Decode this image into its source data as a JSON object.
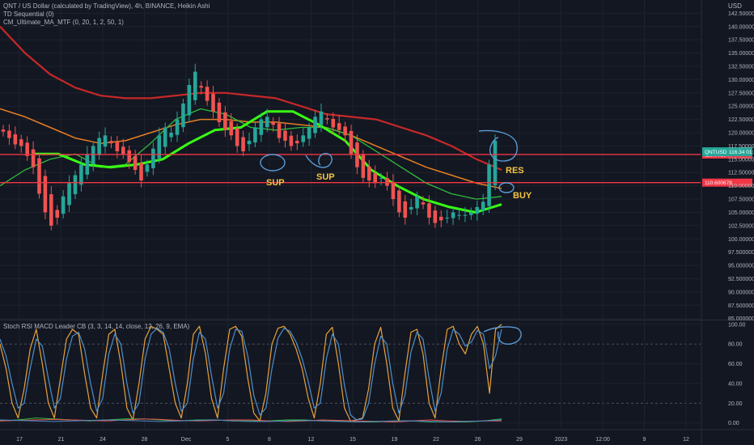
{
  "legend": {
    "title": "QNT / US Dollar (calculated by TradingView), 4h, BINANCE, Heikin Ashi",
    "ind1": "TD Sequential (0)",
    "ind2": "CM_Ultimate_MA_MTF (0, 20, 1, 2, 50, 1)",
    "osc": "Stoch RSI MACD Leader CB (3, 3, 14, 14, close, 12, 26, 9, EMA)"
  },
  "currency": "USD",
  "colors": {
    "background": "#131722",
    "up": "#26a69a",
    "down": "#ef5350",
    "grid": "#1e222d",
    "res_line": "#f23645",
    "annotation": "#f5c542",
    "drawing": "#5b9bd5",
    "ma_long": "#c62828",
    "ma_mid": "#e67e22",
    "ma_green": "#2ebd3c",
    "ma_bright": "#39ff14",
    "stoch_k": "#e8a23a",
    "stoch_d": "#4d8fcc"
  },
  "chart_data": [
    {
      "type": "candlestick",
      "x_ticks": [
        "17",
        "21",
        "24",
        "28",
        "Dec",
        "5",
        "8",
        "12",
        "15",
        "19",
        "22",
        "26",
        "29",
        "2023",
        "12:00",
        "9",
        "12"
      ],
      "y_ticks": [
        "142.500000",
        "140.000000",
        "137.500000",
        "135.000000",
        "132.500000",
        "130.000000",
        "127.500000",
        "125.000000",
        "122.500000",
        "120.000000",
        "117.500000",
        "115.000000",
        "112.500000",
        "110.000000",
        "107.500000",
        "105.000000",
        "102.500000",
        "100.000000",
        "97.500000",
        "95.000000",
        "92.500000",
        "90.000000",
        "87.500000",
        "85.000000"
      ],
      "ylim": [
        84.8,
        145.0
      ],
      "close": [
        120.2,
        119.0,
        117.8,
        117.5,
        115.6,
        113.5,
        108.5,
        105.0,
        102.5,
        104.0,
        108.0,
        110.5,
        112.0,
        114.0,
        116.0,
        117.5,
        119.0,
        119.5,
        118.0,
        116.5,
        116.0,
        114.5,
        113.0,
        111.0,
        114.0,
        117.0,
        119.5,
        121.0,
        120.0,
        122.5,
        125.5,
        129.0,
        131.5,
        128.5,
        126.0,
        124.0,
        122.0,
        120.5,
        119.5,
        117.5,
        116.5,
        118.5,
        121.0,
        122.5,
        123.0,
        121.5,
        119.0,
        118.5,
        117.5,
        118.0,
        119.5,
        121.0,
        123.0,
        124.0,
        122.5,
        121.0,
        120.5,
        119.5,
        116.0,
        113.5,
        111.5,
        111.0,
        110.5,
        111.5,
        110.0,
        107.5,
        105.0,
        104.0,
        106.0,
        108.0,
        106.5,
        104.0,
        103.0,
        103.5,
        104.0,
        105.0,
        104.5,
        104.5,
        105.0,
        106.0,
        107.0,
        114.0,
        118.5
      ],
      "resistance_lines": [
        {
          "value": 115.9,
          "label": "115.901944"
        },
        {
          "value": 110.6,
          "label": "110.600678"
        }
      ],
      "last_price": {
        "symbol": "QNTUSD",
        "value": "116.34",
        "sub": "01:34:54"
      },
      "moving_averages": [
        {
          "values": [
            140.0,
            135.0,
            131.0,
            128.5,
            127.0,
            126.5,
            126.5,
            127.0,
            127.5,
            127.5,
            127.0,
            126.5,
            125.0,
            123.5,
            123.0,
            122.5,
            121.0,
            119.5,
            117.5,
            115.0,
            113.0
          ]
        },
        {
          "values": [
            124.5,
            123.0,
            121.0,
            119.0,
            118.0,
            118.5,
            120.0,
            121.5,
            122.5,
            122.5,
            122.0,
            122.0,
            121.5,
            121.0,
            119.5,
            117.5,
            115.5,
            113.5,
            112.0,
            110.5,
            109.5
          ]
        },
        {
          "values": [
            110.0,
            113.0,
            115.0,
            116.0,
            113.5,
            114.0,
            118.0,
            122.5,
            124.5,
            123.5,
            121.0,
            120.5,
            121.0,
            121.0,
            119.5,
            116.5,
            113.5,
            110.5,
            108.5,
            107.5,
            108.0
          ]
        },
        {
          "values": [
            116.0,
            116.0,
            114.0,
            113.5,
            114.0,
            115.0,
            118.0,
            120.5,
            121.0,
            124.0,
            124.0,
            121.5,
            118.5,
            113.0,
            110.0,
            107.5,
            106.0,
            105.0,
            106.5
          ]
        }
      ],
      "annotations": [
        "SUP",
        "SUP",
        "RES",
        "BUY"
      ]
    },
    {
      "type": "line",
      "y_ticks": [
        "100.00",
        "80.00",
        "60.00",
        "40.00",
        "20.00",
        "0.00"
      ],
      "ylim": [
        -6,
        104
      ],
      "series": [
        {
          "values": [
            80,
            55,
            20,
            5,
            35,
            75,
            95,
            60,
            20,
            5,
            45,
            85,
            95,
            90,
            50,
            15,
            5,
            50,
            90,
            95,
            60,
            15,
            3,
            40,
            85,
            98,
            95,
            90,
            55,
            20,
            5,
            40,
            90,
            98,
            70,
            25,
            5,
            55,
            95,
            98,
            88,
            45,
            10,
            2,
            30,
            80,
            96,
            98,
            90,
            75,
            55,
            25,
            5,
            40,
            90,
            97,
            60,
            15,
            2,
            3,
            5,
            35,
            80,
            97,
            60,
            15,
            2,
            50,
            92,
            95,
            70,
            20,
            5,
            55,
            95,
            98,
            80,
            70,
            90,
            98,
            80,
            30,
            95,
            100
          ]
        },
        {
          "values": [
            85,
            68,
            40,
            15,
            20,
            55,
            85,
            78,
            45,
            15,
            25,
            65,
            88,
            92,
            75,
            40,
            12,
            25,
            70,
            90,
            80,
            40,
            10,
            20,
            65,
            90,
            96,
            92,
            75,
            40,
            12,
            20,
            65,
            92,
            85,
            48,
            15,
            30,
            75,
            95,
            93,
            68,
            28,
            8,
            15,
            55,
            86,
            96,
            93,
            82,
            65,
            42,
            15,
            20,
            65,
            90,
            80,
            38,
            8,
            3,
            4,
            20,
            60,
            88,
            80,
            40,
            10,
            28,
            72,
            92,
            85,
            45,
            12,
            30,
            75,
            95,
            90,
            78,
            82,
            94,
            90,
            55,
            68,
            95
          ]
        },
        {
          "values": [
            2,
            3,
            5,
            4,
            3,
            2,
            3,
            4,
            4,
            3,
            2,
            3,
            3,
            2,
            2,
            2,
            3,
            3,
            2,
            2,
            1,
            1,
            2,
            2,
            1,
            1,
            1,
            2,
            4
          ]
        },
        {
          "values": [
            2,
            2.5,
            3,
            3.5,
            3,
            2.5,
            2,
            3,
            4,
            3.5,
            2.5,
            2,
            2.5,
            3,
            3,
            2,
            1.5,
            2,
            3,
            2.5,
            2,
            1.5,
            1,
            2,
            3,
            2,
            1.5,
            2,
            2
          ]
        },
        {
          "values": [
            3,
            2.5,
            2,
            1.5,
            2,
            2.5,
            3,
            2.5,
            2,
            1.5,
            2,
            2.5,
            3,
            2,
            1.5,
            1.5,
            2,
            2.5,
            2,
            1.5,
            1,
            1.5,
            2,
            2,
            1.5,
            1,
            1.5,
            2,
            3
          ]
        }
      ]
    }
  ]
}
